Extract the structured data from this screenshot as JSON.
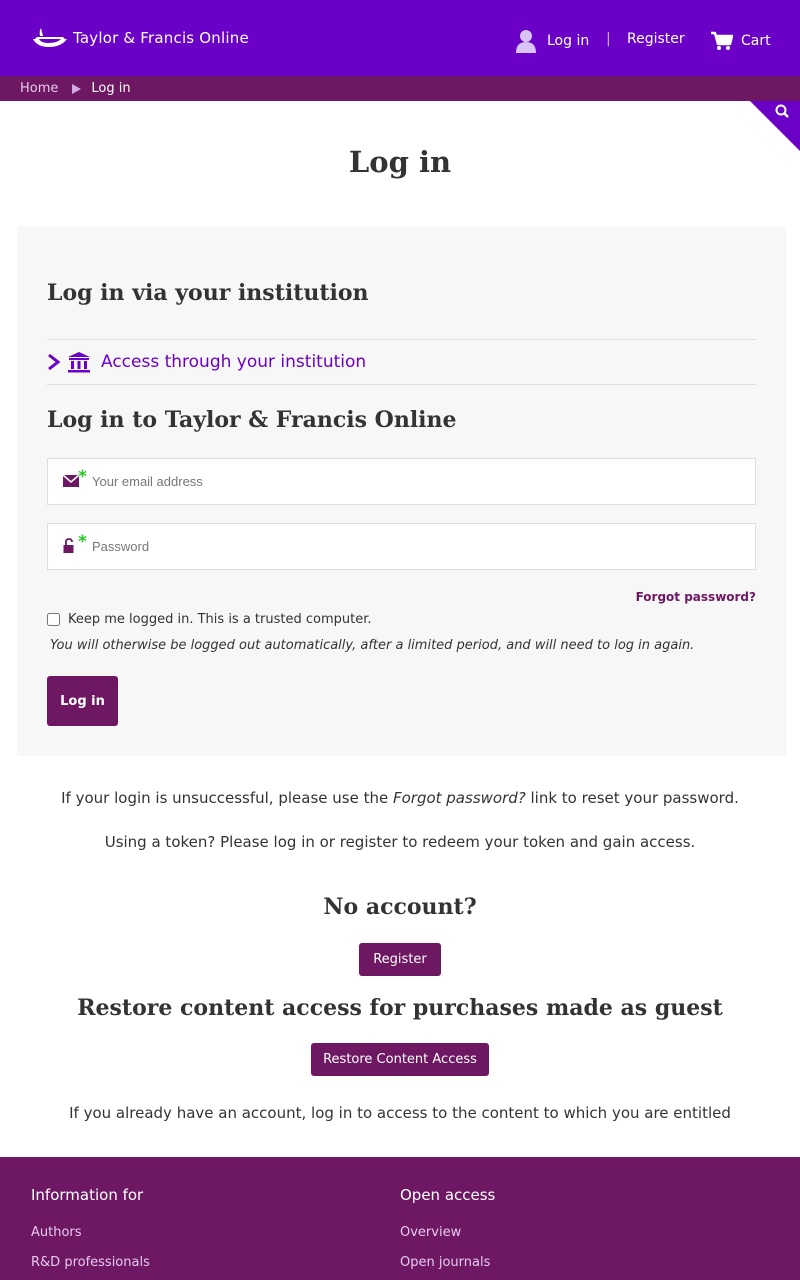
{
  "header": {
    "logo_text": "Taylor & Francis Online",
    "login_label": "Log in",
    "separator": "|",
    "register_label": "Register",
    "cart_label": "Cart"
  },
  "breadcrumb": {
    "home": "Home",
    "current": "Log in"
  },
  "page_title": "Log in",
  "institution": {
    "heading": "Log in via your institution",
    "link_label": "Access through your institution"
  },
  "login_form": {
    "heading": "Log in to Taylor & Francis Online",
    "email_placeholder": "Your email address",
    "password_placeholder": "Password",
    "required_marker": "*",
    "forgot_label": "Forgot password?",
    "keep_logged_label": "Keep me logged in. This is a trusted computer.",
    "keep_logged_note": "You will otherwise be logged out automatically, after a limited period, and will need to log in again.",
    "submit_label": "Log in"
  },
  "notes": {
    "unsuccessful_prefix": "If your login is unsuccessful, please use the ",
    "unsuccessful_link": "Forgot password?",
    "unsuccessful_suffix": " link to reset your password.",
    "token": "Using a token? Please log in or register to redeem your token and gain access."
  },
  "no_account": {
    "heading": "No account?",
    "register_label": "Register"
  },
  "restore": {
    "heading": "Restore content access for purchases made as guest",
    "button_label": "Restore Content Access",
    "note": "If you already have an account, log in to access to the content to which you are entitled"
  },
  "footer": {
    "col1": {
      "heading": "Information for",
      "links": [
        "Authors",
        "R&D professionals"
      ]
    },
    "col2": {
      "heading": "Open access",
      "links": [
        "Overview",
        "Open journals"
      ]
    }
  },
  "colors": {
    "brand_purple": "#6b00c7",
    "dark_purple": "#6e1863",
    "required_green": "#2ac92a"
  }
}
